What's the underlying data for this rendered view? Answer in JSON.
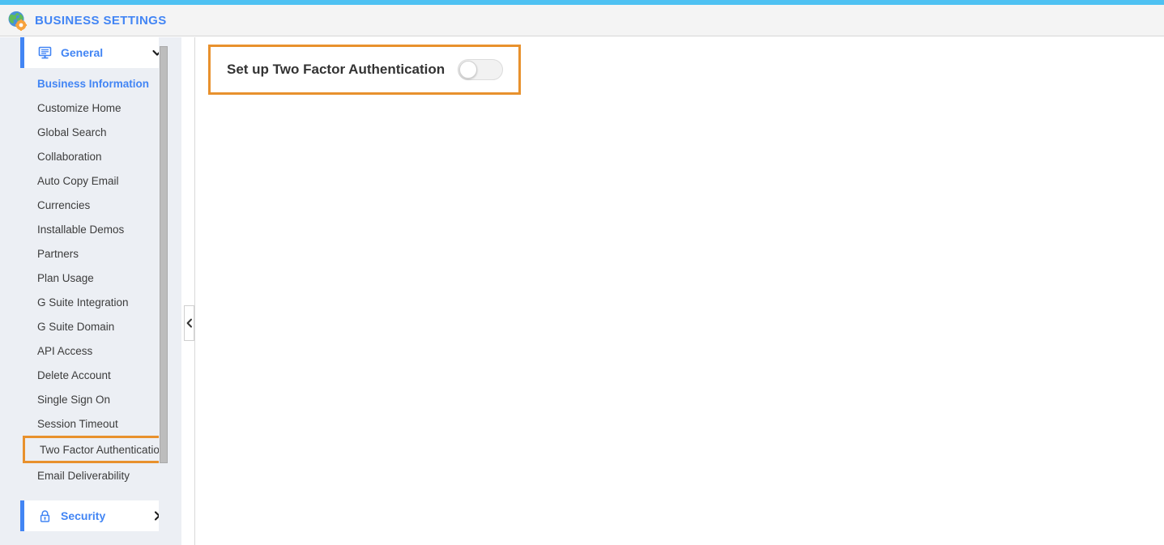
{
  "header": {
    "title": "BUSINESS SETTINGS",
    "logo_icon": "globe-gear-icon",
    "accent_color": "#4ec1f2",
    "title_color": "#4285f4"
  },
  "sidebar": {
    "sections": [
      {
        "label": "General",
        "icon": "monitor-icon",
        "chevron": "chevron-down-icon",
        "expanded": true,
        "items": [
          {
            "label": "Business Information",
            "state": "active"
          },
          {
            "label": "Customize Home",
            "state": "normal"
          },
          {
            "label": "Global Search",
            "state": "normal"
          },
          {
            "label": "Collaboration",
            "state": "normal"
          },
          {
            "label": "Auto Copy Email",
            "state": "normal"
          },
          {
            "label": "Currencies",
            "state": "normal"
          },
          {
            "label": "Installable Demos",
            "state": "normal"
          },
          {
            "label": "Partners",
            "state": "normal"
          },
          {
            "label": "Plan Usage",
            "state": "normal"
          },
          {
            "label": "G Suite Integration",
            "state": "normal"
          },
          {
            "label": "G Suite Domain",
            "state": "normal"
          },
          {
            "label": "API Access",
            "state": "normal"
          },
          {
            "label": "Delete Account",
            "state": "normal"
          },
          {
            "label": "Single Sign On",
            "state": "normal"
          },
          {
            "label": "Session Timeout",
            "state": "normal"
          },
          {
            "label": "Two Factor Authentication",
            "state": "highlighted"
          },
          {
            "label": "Email Deliverability",
            "state": "normal"
          }
        ]
      },
      {
        "label": "Security",
        "icon": "lock-icon",
        "chevron": "chevron-right-icon",
        "expanded": false,
        "items": []
      }
    ],
    "collapse_handle_icon": "chevron-left-icon",
    "scrollbar": "vertical-scrollbar",
    "background_color": "#eceff4",
    "highlight_color": "#e8912d"
  },
  "main": {
    "card": {
      "title": "Set up Two Factor Authentication",
      "toggle": {
        "name": "two-factor-authentication-toggle",
        "state": "off",
        "track_color": "#f2f2f2",
        "knob_color": "#ffffff"
      },
      "border_color": "#e8912d"
    }
  }
}
